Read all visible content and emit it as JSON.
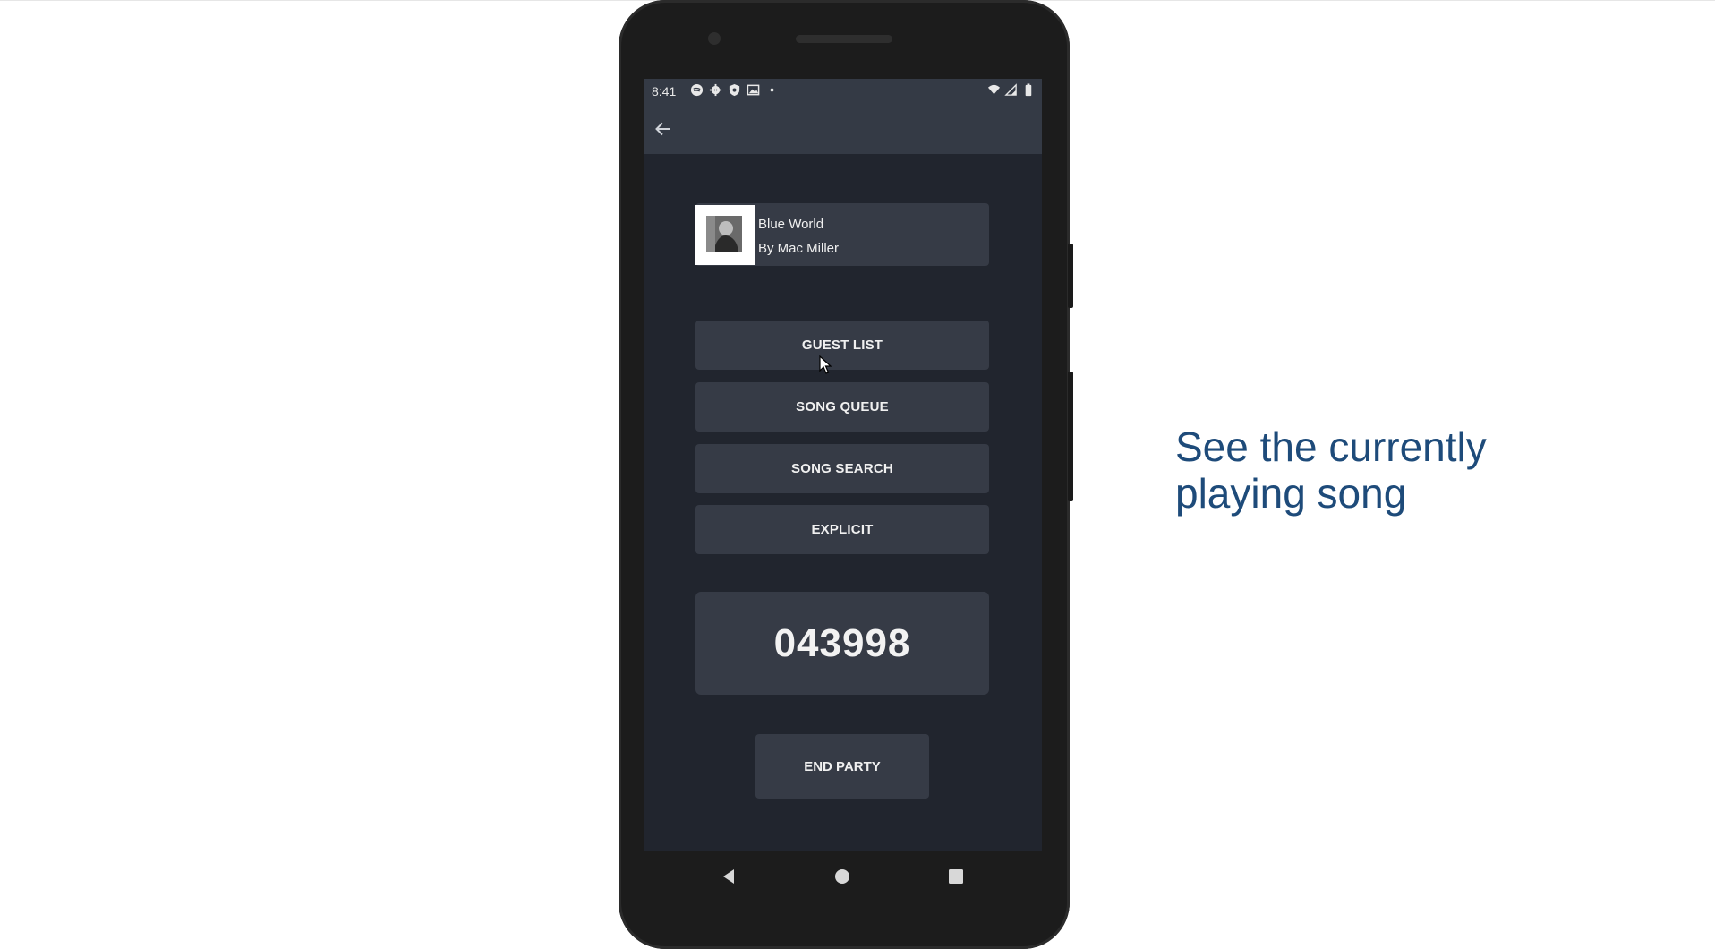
{
  "status_bar": {
    "time": "8:41",
    "icons": [
      "spotify-icon",
      "gear-icon",
      "shield-icon",
      "image-icon",
      "dot-icon"
    ],
    "right_icons": [
      "wifi-icon",
      "signal-icon",
      "battery-icon"
    ]
  },
  "app_bar": {
    "back_icon": "arrow-left-icon"
  },
  "now_playing": {
    "title": "Blue World",
    "artist": "By Mac Miller"
  },
  "menu": {
    "guest_list": "GUEST LIST",
    "song_queue": "SONG QUEUE",
    "song_search": "SONG SEARCH",
    "explicit": "EXPLICIT"
  },
  "party_code": "043998",
  "end_party": "END PARTY",
  "nav": {
    "back": "back-triangle-icon",
    "home": "home-circle-icon",
    "recents": "recents-square-icon"
  },
  "caption": {
    "line1": "See the currently",
    "line2": "playing song"
  },
  "colors": {
    "screen_bg": "#21252e",
    "bar_bg": "#343a45",
    "button_bg": "#363b46",
    "caption": "#1e4b7a"
  }
}
